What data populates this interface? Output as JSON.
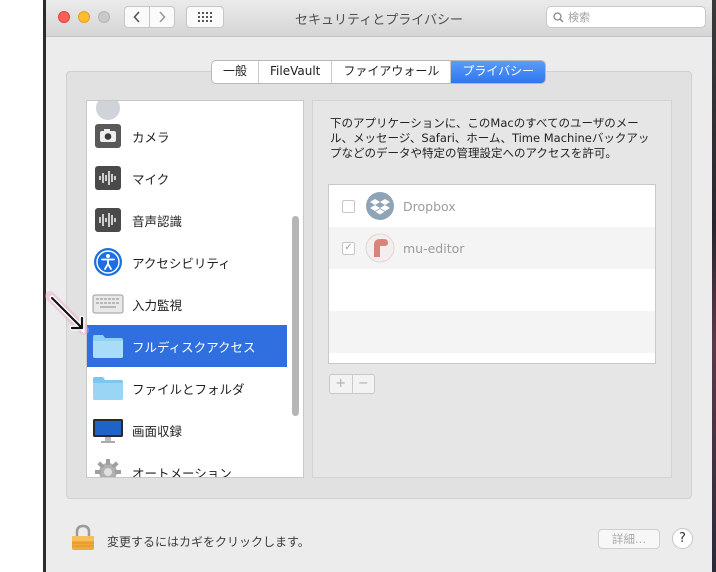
{
  "window": {
    "title": "セキュリティとプライバシー",
    "search_placeholder": "検索"
  },
  "tabs": [
    {
      "label": "一般",
      "active": false
    },
    {
      "label": "FileVault",
      "active": false
    },
    {
      "label": "ファイアウォール",
      "active": false
    },
    {
      "label": "プライバシー",
      "active": true
    }
  ],
  "sidebar": {
    "items": [
      {
        "label": "カメラ",
        "icon": "camera-icon"
      },
      {
        "label": "マイク",
        "icon": "microphone-icon"
      },
      {
        "label": "音声認識",
        "icon": "speech-recognition-icon"
      },
      {
        "label": "アクセシビリティ",
        "icon": "accessibility-icon"
      },
      {
        "label": "入力監視",
        "icon": "keyboard-icon"
      },
      {
        "label": "フルディスクアクセス",
        "icon": "folder-icon",
        "selected": true
      },
      {
        "label": "ファイルとフォルダ",
        "icon": "folder-icon"
      },
      {
        "label": "画面収録",
        "icon": "display-icon"
      },
      {
        "label": "オートメーション",
        "icon": "gear-icon"
      }
    ]
  },
  "main": {
    "description": "下のアプリケーションに、このMacのすべてのユーザのメール、メッセージ、Safari、ホーム、Time Machineバックアップなどのデータや特定の管理設定へのアクセスを許可。",
    "apps": [
      {
        "name": "Dropbox",
        "checked": false,
        "icon": "dropbox-icon"
      },
      {
        "name": "mu-editor",
        "checked": true,
        "icon": "mu-editor-icon"
      }
    ],
    "add_label": "+",
    "remove_label": "−"
  },
  "footer": {
    "lock_text": "変更するにはカギをクリックします。",
    "advanced_label": "詳細...",
    "help_label": "?"
  },
  "colors": {
    "accent": "#2f6fdf",
    "close": "#fe5f57",
    "minimize": "#febc2e"
  }
}
